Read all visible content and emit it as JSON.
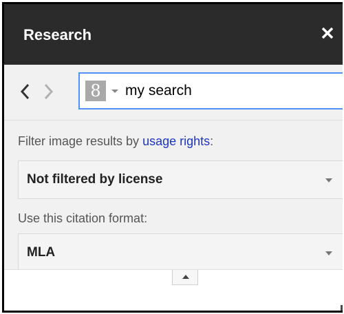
{
  "header": {
    "title": "Research"
  },
  "search": {
    "query": "my search",
    "source_icon": "google-plus-icon",
    "source_glyph": "8"
  },
  "filters": {
    "usage_label_prefix": "Filter image results by ",
    "usage_link": "usage rights",
    "usage_label_suffix": ":",
    "license_value": "Not filtered by license",
    "citation_label": "Use this citation format:",
    "citation_value": "MLA"
  },
  "colors": {
    "header_bg": "#2b2b2b",
    "panel_bg": "#f1f1f1",
    "focus_border": "#4d90fe",
    "link": "#1a35c6"
  }
}
